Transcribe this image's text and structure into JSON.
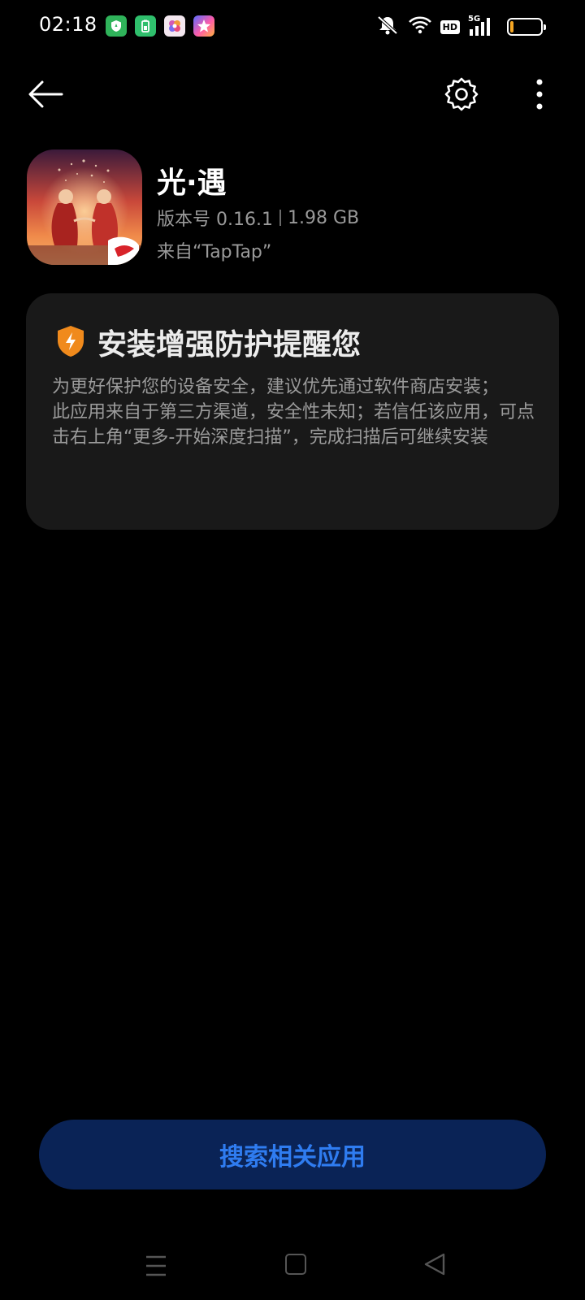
{
  "status_bar": {
    "time": "02:18",
    "hd_label": "HD",
    "network_label": "5G",
    "battery_level": 0.12,
    "notification_icons": [
      "shield-app-icon",
      "battery-app-icon",
      "flower-app-icon",
      "star-app-icon"
    ]
  },
  "toolbar": {
    "back_icon": "arrow-left-icon",
    "settings_icon": "gear-icon",
    "more_icon": "more-vertical-icon"
  },
  "app": {
    "name": "光·遇",
    "version_text": "版本号 0.16.1",
    "size_text": "1.98 GB",
    "source_text": "来自“TapTap”"
  },
  "warning": {
    "title": "安装增强防护提醒您",
    "paragraph_1": "为更好保护您的设备安全，建议优先通过软件商店安装；",
    "paragraph_2": "此应用来自于第三方渠道，安全性未知；若信任该应用，可点击右上角“更多-开始深度扫描”，完成扫描后可继续安装",
    "accent_color": "#f08a1c"
  },
  "actions": {
    "search_related_label": "搜索相关应用",
    "button_color": "#0a2356",
    "button_text_color": "#2f7cf0"
  },
  "nav_bar": {
    "icons": [
      "menu-icon",
      "home-icon",
      "back-triangle-icon"
    ]
  }
}
